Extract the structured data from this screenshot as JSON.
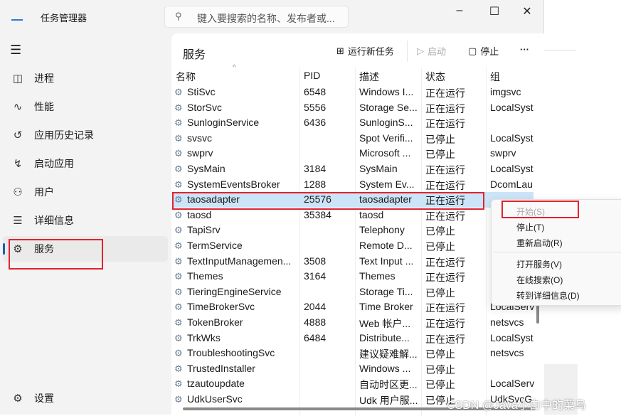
{
  "app": {
    "title": "任务管理器",
    "search_placeholder": "键入要搜索的名称、发布者或..."
  },
  "sidebar": {
    "items": [
      {
        "label": "进程",
        "icon": "processes-icon"
      },
      {
        "label": "性能",
        "icon": "performance-icon"
      },
      {
        "label": "应用历史记录",
        "icon": "history-icon"
      },
      {
        "label": "启动应用",
        "icon": "startup-icon"
      },
      {
        "label": "用户",
        "icon": "users-icon"
      },
      {
        "label": "详细信息",
        "icon": "details-icon"
      },
      {
        "label": "服务",
        "icon": "services-icon",
        "selected": true
      }
    ],
    "settings": "设置"
  },
  "toolbar": {
    "title": "服务",
    "run_new_task": "运行新任务",
    "start": "启动",
    "stop": "停止",
    "more": "···"
  },
  "table": {
    "columns": [
      "名称",
      "PID",
      "描述",
      "状态",
      "组"
    ],
    "rows": [
      [
        "StiSvc",
        "6548",
        "Windows I...",
        "正在运行",
        "imgsvc"
      ],
      [
        "StorSvc",
        "5556",
        "Storage Se...",
        "正在运行",
        "LocalSyst"
      ],
      [
        "SunloginService",
        "6436",
        "SunloginS...",
        "正在运行",
        ""
      ],
      [
        "svsvc",
        "",
        "Spot Verifi...",
        "已停止",
        "LocalSyst"
      ],
      [
        "swprv",
        "",
        "Microsoft ...",
        "已停止",
        "swprv"
      ],
      [
        "SysMain",
        "3184",
        "SysMain",
        "正在运行",
        "LocalSyst"
      ],
      [
        "SystemEventsBroker",
        "1288",
        "System Ev...",
        "正在运行",
        "DcomLau"
      ],
      [
        "taosadapter",
        "25576",
        "taosadapter",
        "正在运行",
        ""
      ],
      [
        "taosd",
        "35384",
        "taosd",
        "正在运行",
        ""
      ],
      [
        "TapiSrv",
        "",
        "Telephony",
        "已停止",
        ""
      ],
      [
        "TermService",
        "",
        "Remote D...",
        "已停止",
        ""
      ],
      [
        "TextInputManagemen...",
        "3508",
        "Text Input ...",
        "正在运行",
        ""
      ],
      [
        "Themes",
        "3164",
        "Themes",
        "正在运行",
        ""
      ],
      [
        "TieringEngineService",
        "",
        "Storage Ti...",
        "已停止",
        ""
      ],
      [
        "TimeBrokerSvc",
        "2044",
        "Time Broker",
        "正在运行",
        "LocalServ"
      ],
      [
        "TokenBroker",
        "4888",
        "Web 帐户...",
        "正在运行",
        "netsvcs"
      ],
      [
        "TrkWks",
        "6484",
        "Distribute...",
        "正在运行",
        "LocalSyst"
      ],
      [
        "TroubleshootingSvc",
        "",
        "建议疑难解...",
        "已停止",
        "netsvcs"
      ],
      [
        "TrustedInstaller",
        "",
        "Windows ...",
        "已停止",
        ""
      ],
      [
        "tzautoupdate",
        "",
        "自动时区更...",
        "已停止",
        "LocalServ"
      ],
      [
        "UdkUserSvc",
        "",
        "Udk 用户服...",
        "已停止",
        "UdkSvcG"
      ]
    ],
    "selected_row": 7
  },
  "context_menu": {
    "items": [
      {
        "label": "开始(S)",
        "disabled": true
      },
      {
        "label": "停止(T)"
      },
      {
        "label": "重新启动(R)"
      },
      {
        "label": "打开服务(V)"
      },
      {
        "label": "在线搜索(O)"
      },
      {
        "label": "转到详细信息(D)"
      }
    ]
  },
  "watermark": "CSDN @Java小白中的菜鸟",
  "colors": {
    "accent": "#1a5fb4",
    "selection": "#cce4f7",
    "highlight_box": "#e0242f"
  }
}
